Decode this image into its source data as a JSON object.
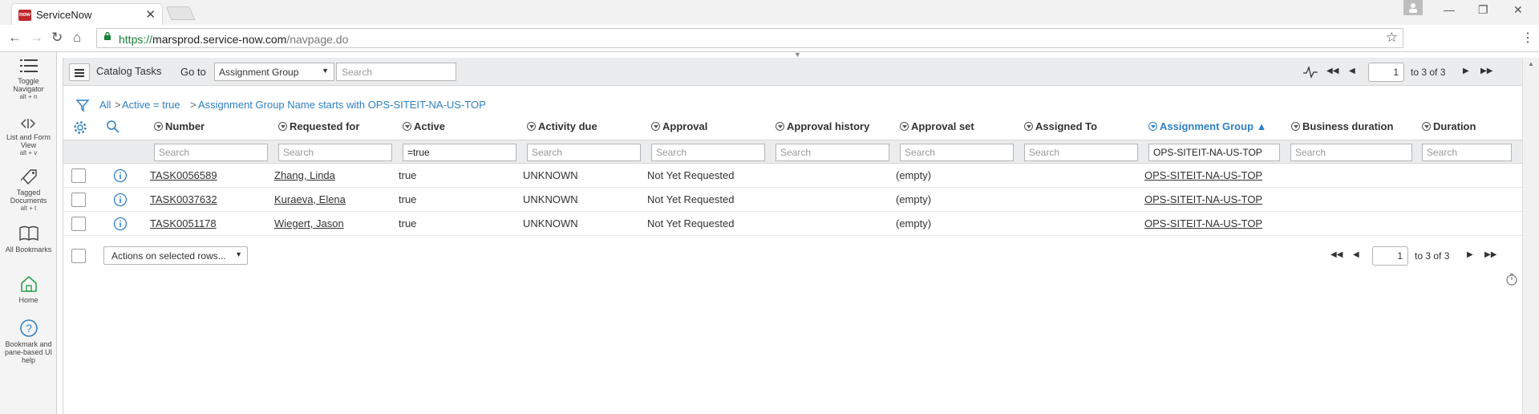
{
  "browser": {
    "tab_title": "ServiceNow",
    "tab_favicon_text": "now",
    "url_scheme": "https://",
    "url_host": "marsprod.service-now.com",
    "url_path": "/navpage.do"
  },
  "sidebar": {
    "items": [
      {
        "label_lines": [
          "Toggle",
          "Navigator"
        ],
        "shortcut": "alt + n",
        "icon": "list-icon"
      },
      {
        "label_lines": [
          "List and Form",
          "View"
        ],
        "shortcut": "alt + v",
        "icon": "split-view-icon"
      },
      {
        "label_lines": [
          "Tagged",
          "Documents"
        ],
        "shortcut": "alt + t",
        "icon": "tag-icon"
      },
      {
        "label_lines": [
          "All Bookmarks"
        ],
        "shortcut": "",
        "icon": "book-icon"
      },
      {
        "label_lines": [
          "Home"
        ],
        "shortcut": "",
        "icon": "home-icon"
      },
      {
        "label_lines": [
          "Bookmark and",
          "pane-based UI",
          "help"
        ],
        "shortcut": "",
        "icon": "help-icon"
      }
    ]
  },
  "list_header": {
    "title": "Catalog Tasks",
    "goto_label": "Go to",
    "goto_field": "Assignment Group",
    "search_placeholder": "Search"
  },
  "pager": {
    "page": "1",
    "range_text": "to 3 of 3"
  },
  "breadcrumb": {
    "items": [
      "All",
      "Active = true",
      "Assignment Group Name starts with OPS-SITEIT-NA-US-TOP"
    ],
    "separator": ">"
  },
  "columns": [
    {
      "label": "Number",
      "search": "Search",
      "sorted": false
    },
    {
      "label": "Requested for",
      "search": "Search",
      "sorted": false
    },
    {
      "label": "Active",
      "search": "=true",
      "sorted": false
    },
    {
      "label": "Activity due",
      "search": "Search",
      "sorted": false
    },
    {
      "label": "Approval",
      "search": "Search",
      "sorted": false
    },
    {
      "label": "Approval history",
      "search": "Search",
      "sorted": false
    },
    {
      "label": "Approval set",
      "search": "Search",
      "sorted": false
    },
    {
      "label": "Assigned To",
      "search": "Search",
      "sorted": false
    },
    {
      "label": "Assignment Group",
      "search": "OPS-SITEIT-NA-US-TOP",
      "sorted": true,
      "sort_indicator": "▲"
    },
    {
      "label": "Business duration",
      "search": "Search",
      "sorted": false
    },
    {
      "label": "Duration",
      "search": "Search",
      "sorted": false
    }
  ],
  "rows": [
    [
      "TASK0056589",
      "Zhang, Linda",
      "true",
      "UNKNOWN",
      "Not Yet Requested",
      "",
      "(empty)",
      "",
      "OPS-SITEIT-NA-US-TOP",
      "",
      ""
    ],
    [
      "TASK0037632",
      "Kuraeva, Elena",
      "true",
      "UNKNOWN",
      "Not Yet Requested",
      "",
      "(empty)",
      "",
      "OPS-SITEIT-NA-US-TOP",
      "",
      ""
    ],
    [
      "TASK0051178",
      "Wiegert, Jason",
      "true",
      "UNKNOWN",
      "Not Yet Requested",
      "",
      "(empty)",
      "",
      "OPS-SITEIT-NA-US-TOP",
      "",
      ""
    ]
  ],
  "footer": {
    "actions_label": "Actions on selected rows..."
  },
  "colors": {
    "accent": "#2f80c4",
    "header_bg": "#eaecee",
    "favicon": "#c1272d"
  }
}
